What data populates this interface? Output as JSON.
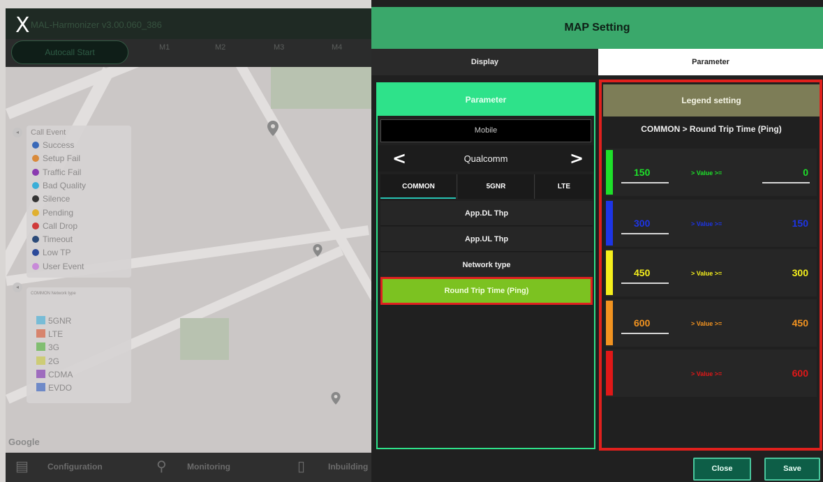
{
  "app": {
    "window_title": "MAL-Harmonizer v3.00.060_386",
    "close_glyph": "X",
    "autocall_label": "Autocall Start",
    "mobile_tabs": [
      "M1",
      "M2",
      "M3",
      "M4"
    ]
  },
  "map": {
    "attribution": "Google",
    "call_event_legend": {
      "title": "Call Event",
      "items": [
        {
          "label": "Success",
          "color": "#3a69b8"
        },
        {
          "label": "Setup Fail",
          "color": "#d98a3a"
        },
        {
          "label": "Traffic Fail",
          "color": "#8a3ab0"
        },
        {
          "label": "Bad Quality",
          "color": "#3aaed8"
        },
        {
          "label": "Silence",
          "color": "#333333"
        },
        {
          "label": "Pending",
          "color": "#e0b030"
        },
        {
          "label": "Call Drop",
          "color": "#d03a3a"
        },
        {
          "label": "Timeout",
          "color": "#2b4a78"
        },
        {
          "label": "Low TP",
          "color": "#2c4a9a"
        },
        {
          "label": "User Event",
          "color": "#c88ad8"
        }
      ]
    },
    "network_legend": {
      "title": "COMMON Network type",
      "items": [
        {
          "label": "5GNR",
          "color": "#3aaed8"
        },
        {
          "label": "LTE",
          "color": "#d8502a"
        },
        {
          "label": "3G",
          "color": "#4ab030"
        },
        {
          "label": "2G",
          "color": "#c8c838"
        },
        {
          "label": "CDMA",
          "color": "#7a28b0"
        },
        {
          "label": "EVDO",
          "color": "#2a58c0"
        }
      ]
    }
  },
  "bottom_nav": {
    "items": [
      {
        "label": "Configuration",
        "icon": "clipboard-icon",
        "glyph": "▤"
      },
      {
        "label": "Monitoring",
        "icon": "search-icon",
        "glyph": "⚲"
      },
      {
        "label": "Inbuilding",
        "icon": "building-icon",
        "glyph": "▯"
      }
    ]
  },
  "dialog": {
    "title": "MAP Setting",
    "tabs": {
      "display": "Display",
      "parameter": "Parameter"
    },
    "parameter_panel": {
      "title": "Parameter",
      "mobile_button": "Mobile",
      "chipset": "Qualcomm",
      "prev_glyph": "<",
      "next_glyph": ">",
      "subtabs": [
        "COMMON",
        "5GNR",
        "LTE"
      ],
      "items": [
        "App.DL Thp",
        "App.UL Thp",
        "Network type"
      ],
      "selected_item": "Round Trip Time (Ping)"
    },
    "legend_panel": {
      "title": "Legend setting",
      "subtitle": "COMMON > Round Trip Time (Ping)",
      "rows": [
        {
          "max": "150",
          "condition": "> Value >=",
          "min": "0",
          "color": "#1ee02a"
        },
        {
          "max": "300",
          "condition": "> Value >=",
          "min": "150",
          "color": "#1d35e6"
        },
        {
          "max": "450",
          "condition": "> Value >=",
          "min": "300",
          "color": "#f5ef1c"
        },
        {
          "max": "600",
          "condition": "> Value >=",
          "min": "450",
          "color": "#f29320"
        },
        {
          "max": "",
          "condition": "> Value >=",
          "min": "600",
          "color": "#e01818"
        }
      ]
    },
    "buttons": {
      "close": "Close",
      "save": "Save"
    }
  }
}
